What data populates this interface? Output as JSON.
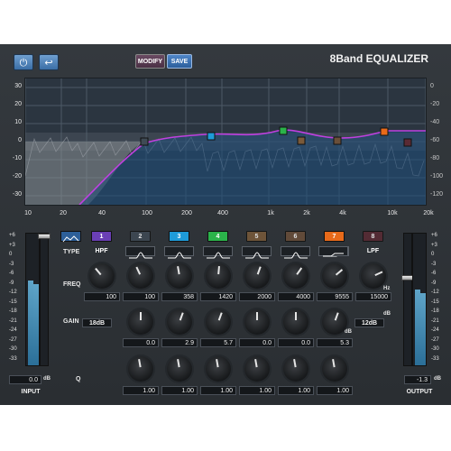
{
  "header": {
    "title": "8Band EQUALIZER",
    "modify_label": "MODIFY",
    "save_label": "SAVE",
    "power_icon": "power-icon",
    "undo_icon": "undo-arrow-icon"
  },
  "graph": {
    "gain_labels_left": [
      "30",
      "20",
      "10",
      "0",
      "-10",
      "-20",
      "-30"
    ],
    "spectrum_labels_right": [
      "0",
      "-20",
      "-40",
      "-60",
      "-80",
      "-100",
      "-120"
    ],
    "freq_labels": [
      "10",
      "20",
      "40",
      "100",
      "200",
      "400",
      "1k",
      "2k",
      "4k",
      "10k",
      "20k"
    ],
    "band_colors": [
      "#6a3fb5",
      "#3f4a55",
      "#1e9bd8",
      "#2bb34a",
      "#7a5a3a",
      "#6a4f3a",
      "#e86a1a",
      "#5a2a34"
    ]
  },
  "row_labels": {
    "type": "TYPE",
    "freq": "FREQ",
    "gain": "GAIN",
    "q": "Q"
  },
  "bands": [
    {
      "num": "1",
      "type_label": "HPF",
      "type": "highpass",
      "freq": "100",
      "gain": "18dB",
      "q": "",
      "active": true
    },
    {
      "num": "2",
      "type_label": "",
      "type": "bell",
      "freq": "100",
      "gain": "0.0",
      "q": "1.00",
      "active": false
    },
    {
      "num": "3",
      "type_label": "",
      "type": "bell",
      "freq": "358",
      "gain": "2.9",
      "q": "1.00",
      "active": true
    },
    {
      "num": "4",
      "type_label": "",
      "type": "bell",
      "freq": "1420",
      "gain": "5.7",
      "q": "1.00",
      "active": true
    },
    {
      "num": "5",
      "type_label": "",
      "type": "bell",
      "freq": "2000",
      "gain": "0.0",
      "q": "1.00",
      "active": false
    },
    {
      "num": "6",
      "type_label": "",
      "type": "bell",
      "freq": "4000",
      "gain": "0.0",
      "q": "1.00",
      "active": false
    },
    {
      "num": "7",
      "type_label": "",
      "type": "high-shelf",
      "freq": "9555",
      "gain": "5.3",
      "q": "1.00",
      "active": true
    },
    {
      "num": "8",
      "type_label": "LPF",
      "type": "lowpass",
      "freq": "15000",
      "gain": "12dB",
      "q": "",
      "active": false
    }
  ],
  "units": {
    "hz": "Hz",
    "db": "dB"
  },
  "meter_scale": [
    "+6",
    "+3",
    "0",
    "-3",
    "-6",
    "-9",
    "-12",
    "-15",
    "-18",
    "-21",
    "-24",
    "-27",
    "-30",
    "-33"
  ],
  "input": {
    "label": "INPUT",
    "value": "0.0",
    "unit": "dB"
  },
  "output": {
    "label": "OUTPUT",
    "value": "-1.3",
    "unit": "dB"
  }
}
